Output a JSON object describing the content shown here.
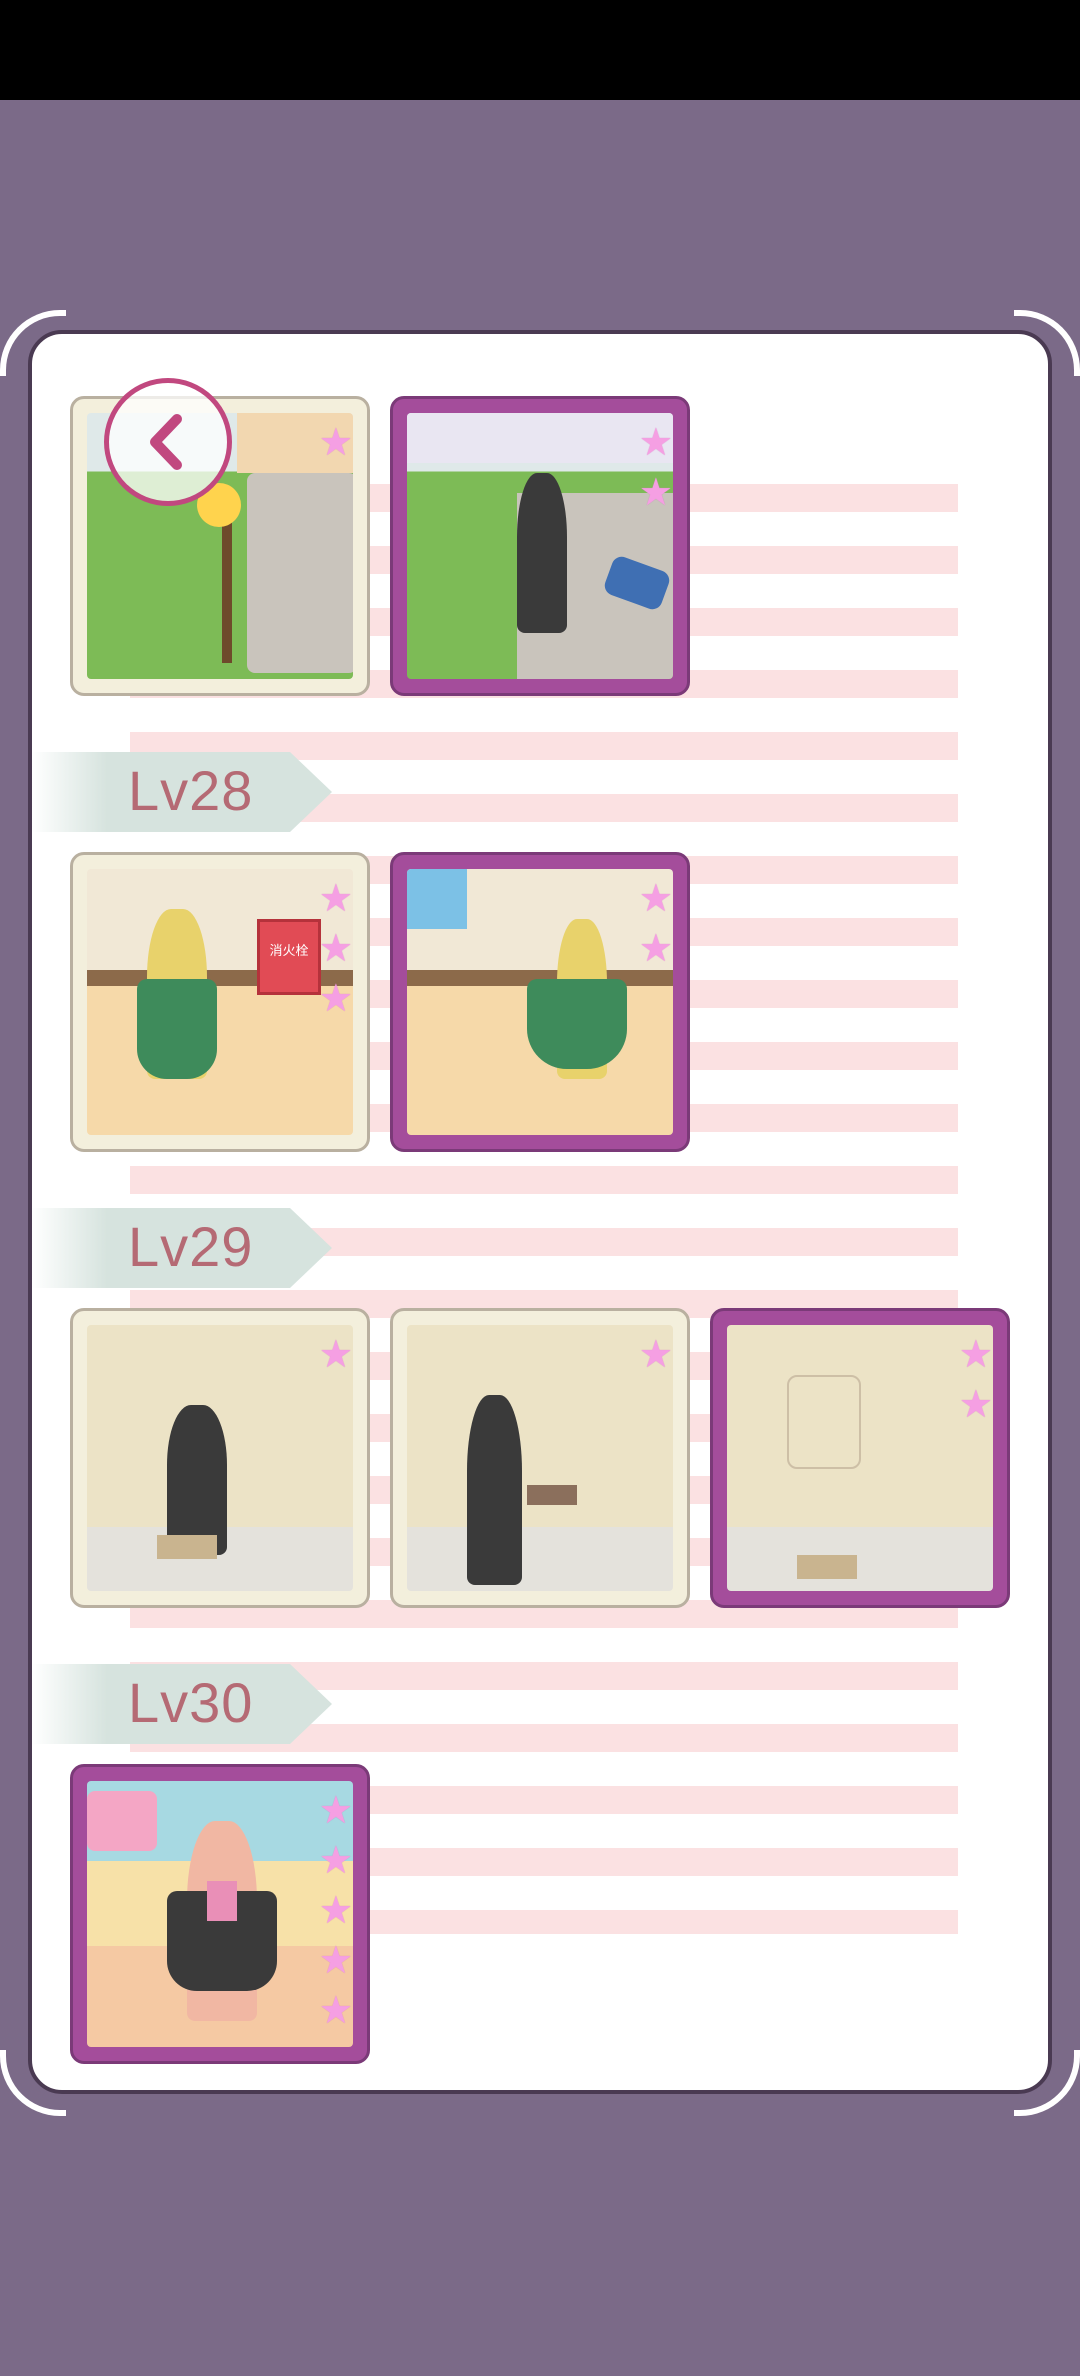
{
  "colors": {
    "background": "#7b6a88",
    "panel": "#ffffff",
    "selected_border": "#a44d9b",
    "star": "#f59fe3",
    "level_label": "#b56a74"
  },
  "back_button": {
    "icon": "chevron-left-icon"
  },
  "levels": [
    {
      "label": "",
      "thumbnails": [
        {
          "stars": 1,
          "selected": false
        },
        {
          "stars": 2,
          "selected": true
        }
      ]
    },
    {
      "label": "Lv28",
      "thumbnails": [
        {
          "stars": 3,
          "selected": false
        },
        {
          "stars": 2,
          "selected": true
        }
      ]
    },
    {
      "label": "Lv29",
      "thumbnails": [
        {
          "stars": 1,
          "selected": false
        },
        {
          "stars": 1,
          "selected": false
        },
        {
          "stars": 2,
          "selected": true
        }
      ]
    },
    {
      "label": "Lv30",
      "thumbnails": [
        {
          "stars": 5,
          "selected": true
        }
      ]
    }
  ],
  "scene_text": {
    "fire_hydrant_sign": "消火栓"
  }
}
